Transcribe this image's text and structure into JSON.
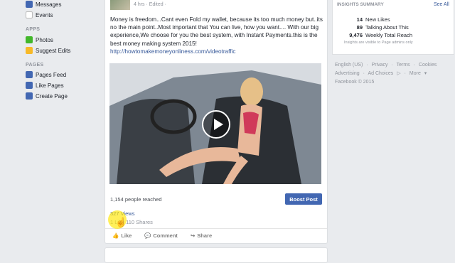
{
  "left_nav": {
    "items_top": [
      {
        "label": "Messages",
        "icon": "messages-icon",
        "color": "#4267b2"
      },
      {
        "label": "Events",
        "icon": "events-icon",
        "color": "#e9ebee"
      }
    ],
    "apps_header": "APPS",
    "apps": [
      {
        "label": "Photos",
        "icon": "photos-icon",
        "color": "#42b72a"
      },
      {
        "label": "Suggest Edits",
        "icon": "suggest-edits-icon",
        "color": "#f7b928"
      }
    ],
    "pages_header": "PAGES",
    "pages": [
      {
        "label": "Pages Feed",
        "icon": "pages-feed-icon",
        "color": "#4267b2"
      },
      {
        "label": "Like Pages",
        "icon": "like-pages-icon",
        "color": "#4267b2"
      },
      {
        "label": "Create Page",
        "icon": "create-page-icon",
        "color": "#4267b2"
      }
    ]
  },
  "post": {
    "meta": "4 hrs · Edited ·",
    "text": "Money is freedom...Cant even Fold my wallet, because its too much money but..its no the main point..Most important that You can live, how you want.... With our big experience,We choose for you the best system, with Instant Payments.this is the best money making system 2015!",
    "link": "http://howtomakemoneyonliness.com/videotraffic",
    "reach": "1,154 people reached",
    "boost_label": "Boost Post",
    "views": "327 Views",
    "likes_shares": "1 Like  110 Shares",
    "actions": {
      "like": "Like",
      "comment": "Comment",
      "share": "Share"
    }
  },
  "insights": {
    "header": "INSIGHTS SUMMARY",
    "see_all": "See All",
    "rows": [
      {
        "num": "14",
        "label": "New Likes"
      },
      {
        "num": "89",
        "label": "Talking About This"
      },
      {
        "num": "9,476",
        "label": "Weekly Total Reach"
      }
    ],
    "note": "Insights are visible to Page admins only"
  },
  "footer": {
    "line1": [
      "English (US)",
      "·",
      "Privacy",
      "·",
      "Terms",
      "·",
      "Cookies"
    ],
    "line2": [
      "Advertising",
      "·",
      "Ad Choices",
      "·",
      "More"
    ],
    "copyright": "Facebook © 2015"
  },
  "colors": {
    "accent": "#4267b2",
    "link": "#365899"
  }
}
